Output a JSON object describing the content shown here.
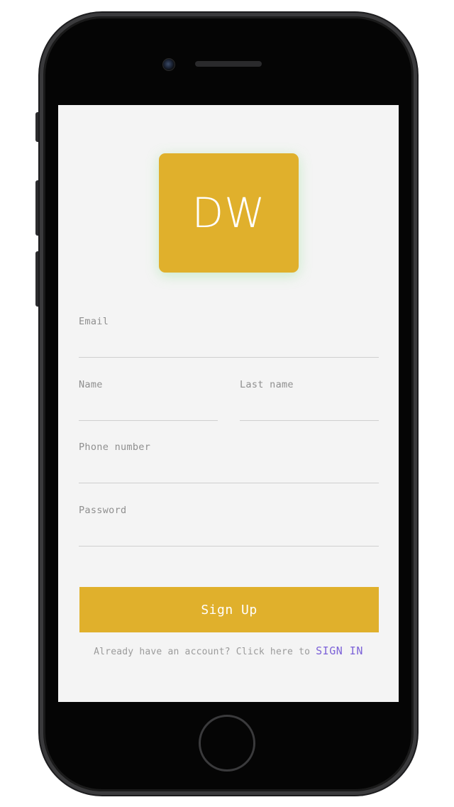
{
  "logo": {
    "text": "DW",
    "color": "#e0b02c"
  },
  "form": {
    "email_label": "Email",
    "email_value": "",
    "name_label": "Name",
    "name_value": "",
    "last_name_label": "Last name",
    "last_name_value": "",
    "phone_label": "Phone number",
    "phone_value": "",
    "password_label": "Password",
    "password_value": ""
  },
  "actions": {
    "signup_label": "Sign Up",
    "signin_prompt": "Already have an account? Click here to",
    "signin_link": "SIGN IN"
  },
  "colors": {
    "accent": "#e0b02c",
    "link": "#7d63d8",
    "screen_bg": "#f4f4f4"
  }
}
